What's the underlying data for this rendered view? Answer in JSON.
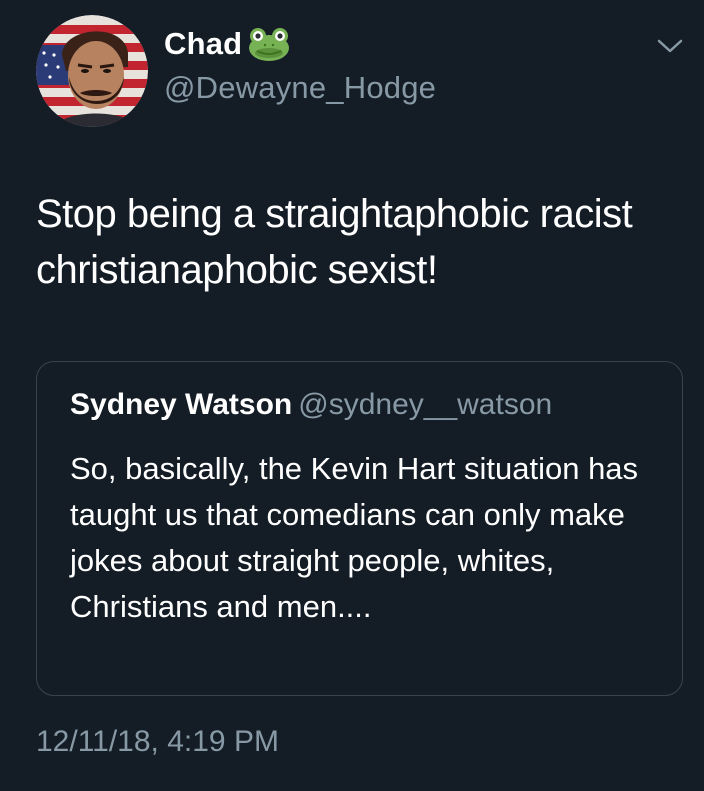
{
  "author": {
    "display_name": "Chad",
    "handle": "@Dewayne_Hodge",
    "name_emoji": "frog-face-icon"
  },
  "tweet": {
    "text": "Stop being a straightaphobic racist christianaphobic sexist!",
    "timestamp": "12/11/18, 4:19 PM"
  },
  "quoted_tweet": {
    "display_name": "Sydney Watson",
    "handle": "@sydney__watson",
    "text": "So, basically, the Kevin Hart situation has taught us that comedians can only make jokes about straight people, whites, Christians and men...."
  },
  "icons": {
    "menu": "chevron-down-icon",
    "avatar": "avatar"
  },
  "colors": {
    "background": "#141d26",
    "primary_text": "#ffffff",
    "secondary_text": "#8899a6",
    "border": "#38444d"
  }
}
